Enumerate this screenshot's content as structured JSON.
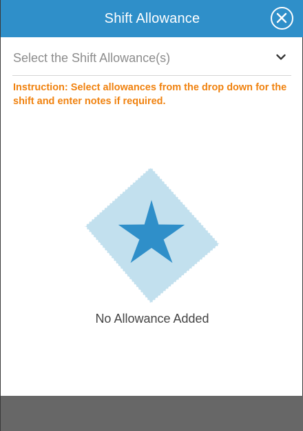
{
  "header": {
    "title": "Shift Allowance",
    "close_icon": "close-icon",
    "background": "#2f8fc9"
  },
  "select": {
    "placeholder": "Select the Shift Allowance(s)",
    "icon": "chevron-down-icon"
  },
  "instruction": {
    "text": "Instruction: Select allowances from the drop down for the shift and enter notes if required.",
    "color": "#f0820f"
  },
  "empty_state": {
    "icon": "star-icon",
    "label": "No Allowance Added",
    "diamond_color": "#c2e0ee",
    "star_color": "#2f8fc9"
  },
  "footer": {
    "background": "#676767"
  }
}
